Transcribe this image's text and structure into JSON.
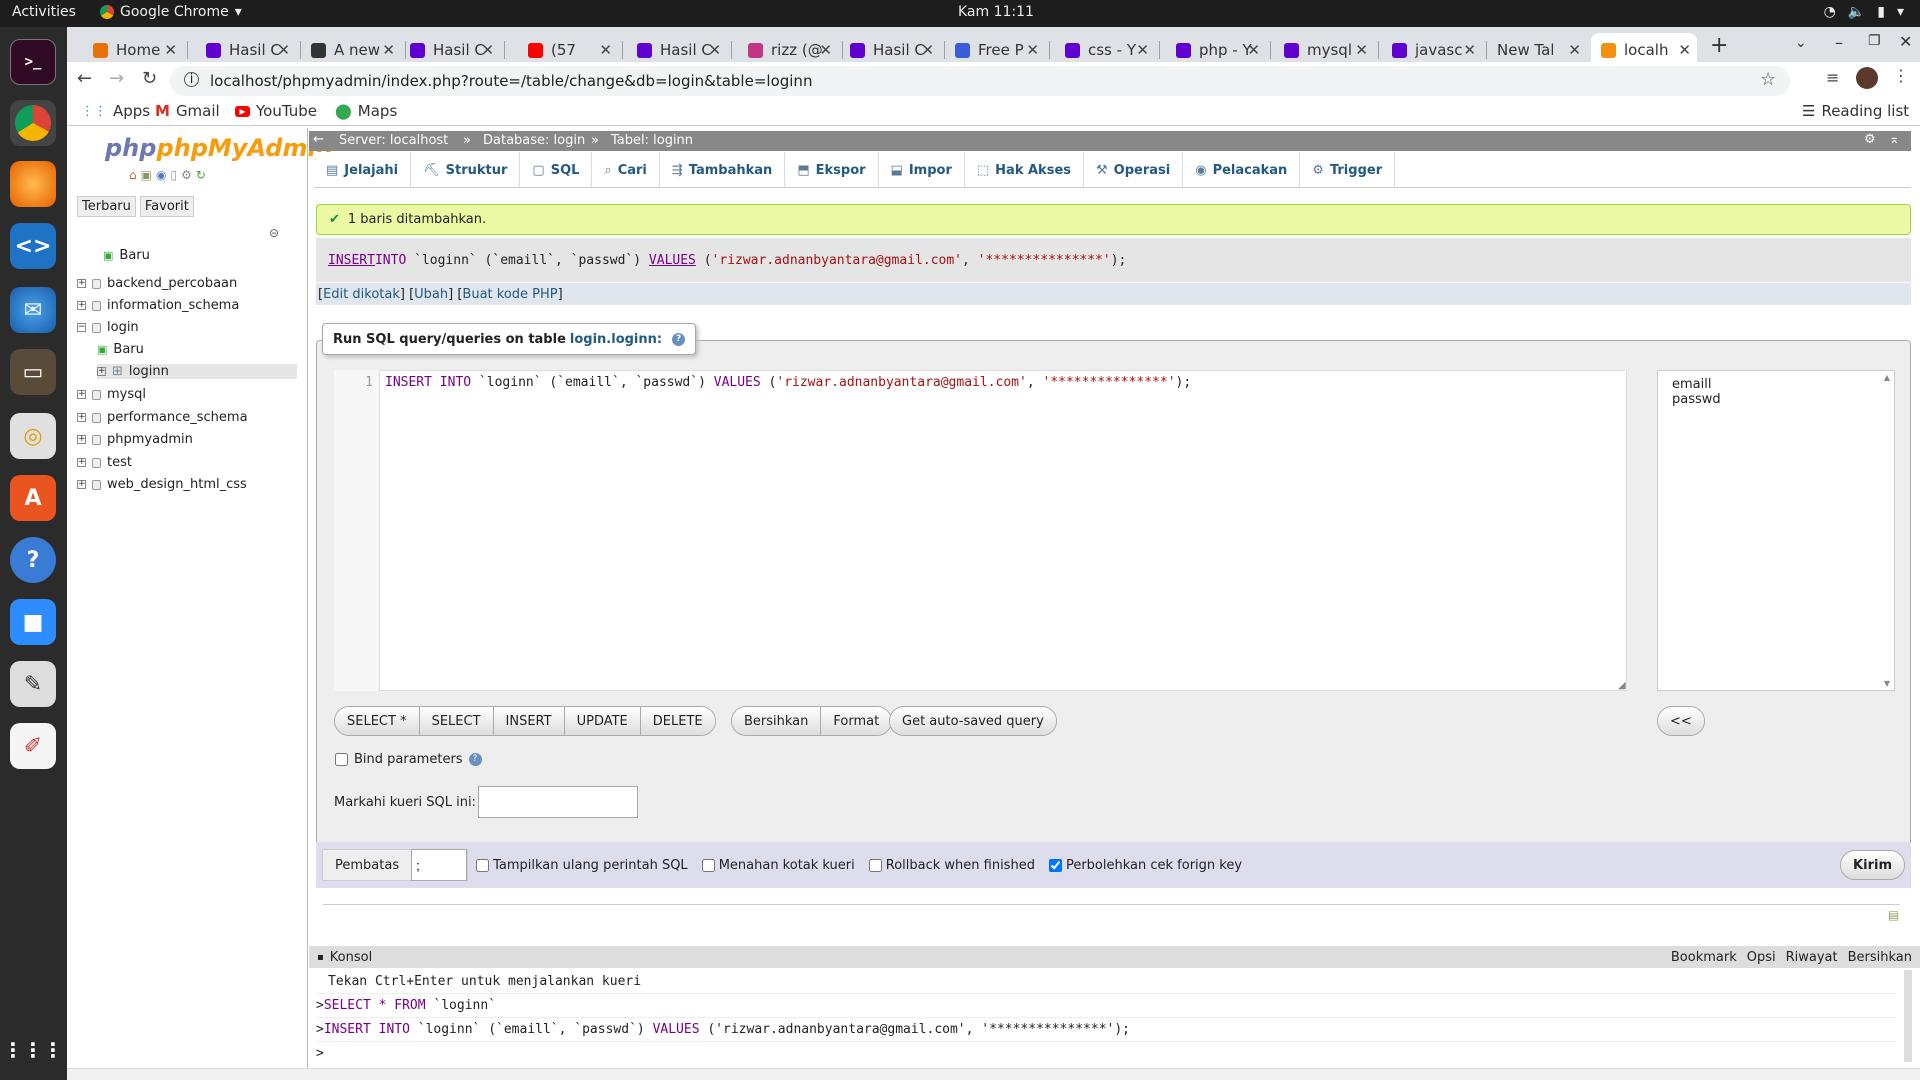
{
  "system": {
    "activities": "Activities",
    "app": "Google Chrome",
    "clock": "Kam 11:11"
  },
  "tabs": [
    {
      "label": "Home",
      "color": "#e8710a"
    },
    {
      "label": "Hasil C",
      "color": "#6001d2"
    },
    {
      "label": "A new",
      "color": "#333333"
    },
    {
      "label": "Hasil C",
      "color": "#6001d2"
    },
    {
      "label": "(57",
      "color": "#ff0000"
    },
    {
      "label": "Hasil C",
      "color": "#6001d2"
    },
    {
      "label": "rizz (@",
      "color": "#c13584"
    },
    {
      "label": "Hasil C",
      "color": "#6001d2"
    },
    {
      "label": "Free P",
      "color": "#3b5bdb"
    },
    {
      "label": "css - Y",
      "color": "#6001d2"
    },
    {
      "label": "php - Y",
      "color": "#6001d2"
    },
    {
      "label": "mysql",
      "color": "#6001d2"
    },
    {
      "label": "javasc",
      "color": "#6001d2"
    },
    {
      "label": "New Tab",
      "color": ""
    },
    {
      "label": "localh",
      "color": "#f29111"
    }
  ],
  "address": {
    "url": "localhost/phpmyadmin/index.php?route=/table/change&db=login&table=loginn"
  },
  "bookmarks": {
    "apps": "Apps",
    "gmail": "Gmail",
    "youtube": "YouTube",
    "maps": "Maps",
    "reading_list": "Reading list"
  },
  "pma": {
    "logo": "phpMyAdmin",
    "nav_tabs": [
      "Terbaru",
      "Favorit"
    ],
    "tree": [
      {
        "label": "Baru",
        "level": 1,
        "kind": "new"
      },
      {
        "label": "backend_percobaan",
        "level": 0,
        "kind": "db"
      },
      {
        "label": "information_schema",
        "level": 0,
        "kind": "db"
      },
      {
        "label": "login",
        "level": 0,
        "kind": "db-open"
      },
      {
        "label": "Baru",
        "level": 1,
        "kind": "new"
      },
      {
        "label": "loginn",
        "level": 1,
        "kind": "table"
      },
      {
        "label": "mysql",
        "level": 0,
        "kind": "db"
      },
      {
        "label": "performance_schema",
        "level": 0,
        "kind": "db"
      },
      {
        "label": "phpmyadmin",
        "level": 0,
        "kind": "db"
      },
      {
        "label": "test",
        "level": 0,
        "kind": "db"
      },
      {
        "label": "web_design_html_css",
        "level": 0,
        "kind": "db"
      }
    ],
    "breadcrumb": {
      "server": "Server: localhost",
      "database": "Database: login",
      "table": "Tabel: loginn"
    },
    "menu": [
      "Jelajahi",
      "Struktur",
      "SQL",
      "Cari",
      "Tambahkan",
      "Ekspor",
      "Impor",
      "Hak Akses",
      "Operasi",
      "Pelacakan",
      "Trigger"
    ],
    "success": "1 baris ditambahkan.",
    "sql_shown": {
      "kw1": "INSERT",
      "kw2": "INTO",
      "rest1": " `loginn` (`emaill`, `passwd`) ",
      "kw3": "VALUES",
      "rest2": " (",
      "v1": "'rizwar.adnanbyantara@gmail.com'",
      "comma": ", ",
      "v2": "'***************'",
      "end": ");"
    },
    "sql_links": {
      "edit_inline": "Edit dikotak",
      "edit": "Ubah",
      "php": "Buat kode PHP"
    },
    "query_box": {
      "legend": "Run SQL query/queries on table ",
      "legend_table": "login.loginn:",
      "line_no": "1"
    },
    "editor": {
      "kw1": "INSERT",
      "kw2": "INTO",
      "t1": " `loginn` (`emaill`, `passwd`) ",
      "kw3": "VALUES",
      "t2": " (",
      "v1": "'rizwar.adnanbyantara@gmail.com'",
      "t3": ", ",
      "v2": "'***************'",
      "t4": ");"
    },
    "columns": [
      "emaill",
      "passwd"
    ],
    "buttons": {
      "select_star": "SELECT *",
      "select": "SELECT",
      "insert": "INSERT",
      "update": "UPDATE",
      "delete": "DELETE",
      "clear": "Bersihkan",
      "format": "Format",
      "autosaved": "Get auto-saved query",
      "collapse": "<<"
    },
    "bind_params": "Bind parameters",
    "bookmark_label": "Markahi kueri SQL ini:",
    "delimiter_label": "Pembatas",
    "delimiter_value": ";",
    "options": [
      {
        "label": "Tampilkan ulang perintah SQL",
        "checked": false
      },
      {
        "label": "Menahan kotak kueri",
        "checked": false
      },
      {
        "label": "Rollback when finished",
        "checked": false
      },
      {
        "label": "Perbolehkan cek forign key",
        "checked": true
      }
    ],
    "submit": "Kirim",
    "console": {
      "title": "Konsol",
      "actions": [
        "Bookmark",
        "Opsi",
        "Riwayat",
        "Bersihkan"
      ],
      "hint": "Tekan Ctrl+Enter untuk menjalankan kueri",
      "q1_prompt": ">",
      "q1_kw": "SELECT * FROM",
      "q1_rest": " `loginn`",
      "q2_prompt": ">",
      "q2_kw": "INSERT INTO",
      "q2_rest": " `loginn` (`emaill`, `passwd`) ",
      "q2_kw2": "VALUES",
      "q2_rest2": " ('rizwar.adnanbyantara@gmail.com', '***************');",
      "prompt": ">"
    }
  }
}
